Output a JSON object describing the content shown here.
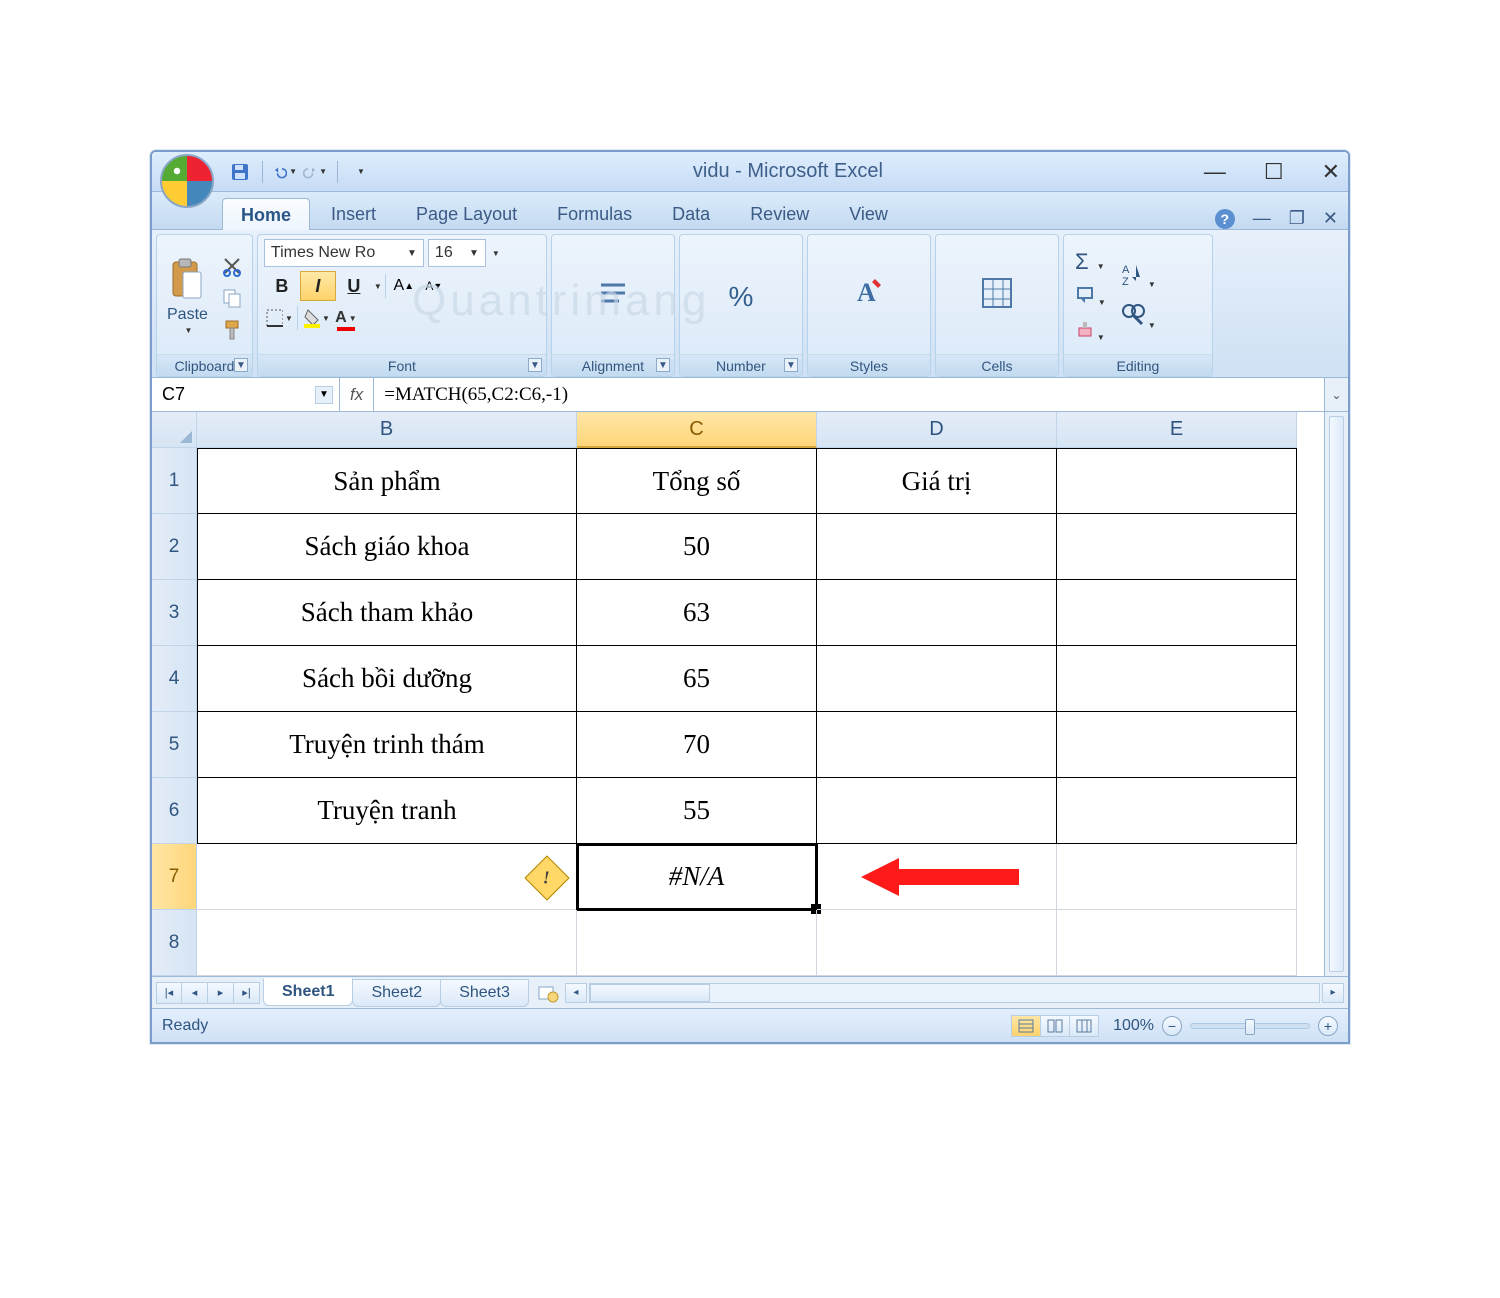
{
  "window_title": "vidu - Microsoft Excel",
  "tabs": {
    "home": "Home",
    "insert": "Insert",
    "page_layout": "Page Layout",
    "formulas": "Formulas",
    "data": "Data",
    "review": "Review",
    "view": "View"
  },
  "ribbon": {
    "clipboard": {
      "label": "Clipboard",
      "paste": "Paste"
    },
    "font": {
      "label": "Font",
      "font_name": "Times New Ro",
      "font_size": "16",
      "bold": "B",
      "italic": "I",
      "underline": "U"
    },
    "alignment": {
      "label": "Alignment"
    },
    "number": {
      "label": "Number",
      "icon": "%"
    },
    "styles": {
      "label": "Styles"
    },
    "cells": {
      "label": "Cells"
    },
    "editing": {
      "label": "Editing",
      "sigma": "Σ"
    }
  },
  "name_box": "C7",
  "formula_bar": "=MATCH(65,C2:C6,-1)",
  "columns": [
    "B",
    "C",
    "D",
    "E"
  ],
  "rows": [
    "1",
    "2",
    "3",
    "4",
    "5",
    "6",
    "7",
    "8"
  ],
  "grid": {
    "r1": {
      "B": "Sản phẩm",
      "C": "Tổng số",
      "D": "Giá trị",
      "E": ""
    },
    "r2": {
      "B": "Sách giáo khoa",
      "C": "50",
      "D": "",
      "E": ""
    },
    "r3": {
      "B": "Sách tham khảo",
      "C": "63",
      "D": "",
      "E": ""
    },
    "r4": {
      "B": "Sách bồi dưỡng",
      "C": "65",
      "D": "",
      "E": ""
    },
    "r5": {
      "B": "Truyện trinh thám",
      "C": "70",
      "D": "",
      "E": ""
    },
    "r6": {
      "B": "Truyện tranh",
      "C": "55",
      "D": "",
      "E": ""
    },
    "r7": {
      "B": "",
      "C": "#N/A",
      "D": "",
      "E": ""
    },
    "r8": {
      "B": "",
      "C": "",
      "D": "",
      "E": ""
    }
  },
  "selected_column": "C",
  "selected_row": "7",
  "sheets": {
    "s1": "Sheet1",
    "s2": "Sheet2",
    "s3": "Sheet3"
  },
  "status": {
    "ready": "Ready",
    "zoom": "100%"
  },
  "watermark": "Quantrimang"
}
